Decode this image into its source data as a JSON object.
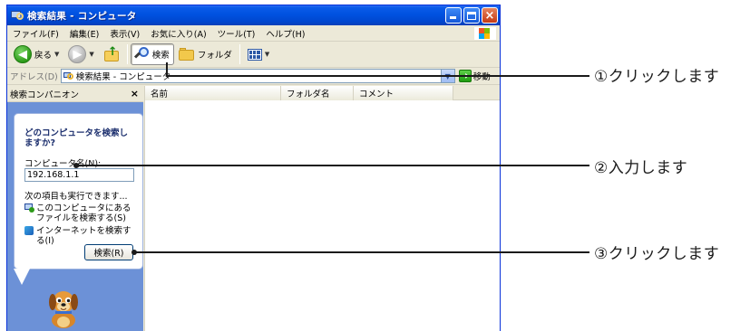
{
  "window": {
    "title": "検索結果 - コンピュータ"
  },
  "menubar": {
    "items": [
      "ファイル(F)",
      "編集(E)",
      "表示(V)",
      "お気に入り(A)",
      "ツール(T)",
      "ヘルプ(H)"
    ]
  },
  "toolbar": {
    "back_label": "戻る",
    "search_label": "検索",
    "folders_label": "フォルダ"
  },
  "address": {
    "label": "アドレス(D)",
    "value": "検索結果 - コンピュータ",
    "go_label": "移動"
  },
  "companion": {
    "header": "検索コンパニオン",
    "close_glyph": "×",
    "question": "どのコンピュータを検索しますか?",
    "computer_name_label": "コンピュータ名(N):",
    "computer_name_value": "192.168.1.1",
    "also_label": "次の項目も実行できます...",
    "option1": "このコンピュータにあるファイルを検索する(S)",
    "option2": "インターネットを検索する(I)",
    "search_button": "検索(R)"
  },
  "results": {
    "columns": [
      "名前",
      "フォルダ名",
      "コメント"
    ]
  },
  "callouts": {
    "step1": "①クリックします",
    "step2": "②入力します",
    "step3": "③クリックします"
  },
  "colors": {
    "titlebar": "#0052e0",
    "pane_background": "#6c91d7",
    "window_chrome": "#ece9d8"
  },
  "icons": {
    "app": "search-computer-icon",
    "back": "back-arrow-icon",
    "forward": "forward-arrow-icon",
    "up": "up-folder-icon",
    "search": "magnifier-icon",
    "folders": "folder-icon",
    "views": "views-icon",
    "go": "go-arrow-icon",
    "mascot": "search-dog-icon"
  }
}
